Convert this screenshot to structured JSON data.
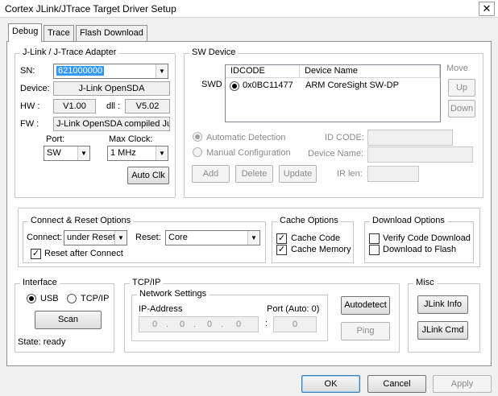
{
  "window": {
    "title": "Cortex JLink/JTrace Target Driver Setup",
    "close_glyph": "✕"
  },
  "tabs": [
    {
      "label": "Debug"
    },
    {
      "label": "Trace"
    },
    {
      "label": "Flash Download"
    }
  ],
  "jlink": {
    "legend": "J-Link / J-Trace Adapter",
    "sn_label": "SN:",
    "sn_value": "621000000",
    "device_label": "Device:",
    "device_value": "J-Link OpenSDA",
    "hw_label": "HW :",
    "hw_value": "V1.00",
    "dll_label": "dll :",
    "dll_value": "V5.02",
    "fw_label": "FW :",
    "fw_value": "J-Link OpenSDA compiled Jur",
    "port_label": "Port:",
    "port_value": "SW",
    "maxclock_label": "Max Clock:",
    "maxclock_value": "1 MHz",
    "autoclk_button": "Auto Clk"
  },
  "swdevice": {
    "legend": "SW Device",
    "swd_label": "SWD",
    "columns": [
      "IDCODE",
      "Device Name"
    ],
    "rows": [
      {
        "idcode": "0x0BC11477",
        "name": "ARM CoreSight SW-DP"
      }
    ],
    "move_label": "Move",
    "up_button": "Up",
    "down_button": "Down",
    "auto_detect_label": "Automatic Detection",
    "manual_config_label": "Manual Configuration",
    "idcode_label": "ID CODE:",
    "device_name_label": "Device Name:",
    "ir_len_label": "IR len:",
    "add_button": "Add",
    "delete_button": "Delete",
    "update_button": "Update"
  },
  "connect": {
    "legend": "Connect & Reset Options",
    "connect_label": "Connect:",
    "connect_value": "under Reset",
    "reset_label": "Reset:",
    "reset_value": "Core",
    "reset_after_connect_label": "Reset after Connect",
    "reset_after_connect_checked": "✓"
  },
  "cache": {
    "legend": "Cache Options",
    "cache_code_label": "Cache Code",
    "cache_code_checked": "✓",
    "cache_memory_label": "Cache Memory",
    "cache_memory_checked": "✓"
  },
  "download": {
    "legend": "Download Options",
    "verify_label": "Verify Code Download",
    "flash_label": "Download to Flash"
  },
  "interface": {
    "legend": "Interface",
    "usb_label": "USB",
    "tcpip_label": "TCP/IP",
    "scan_button": "Scan",
    "state_text": "State: ready"
  },
  "tcpip": {
    "legend": "TCP/IP",
    "network_legend": "Network Settings",
    "ip_label": "IP-Address",
    "port_label": "Port (Auto: 0)",
    "ip_octets": [
      "0",
      "0",
      "0",
      "0"
    ],
    "ip_dot": ".",
    "port_sep": ":",
    "port_value": "0",
    "autodetect_button": "Autodetect",
    "ping_button": "Ping"
  },
  "misc": {
    "legend": "Misc",
    "jlink_info_button": "JLink Info",
    "jlink_cmd_button": "JLink Cmd"
  },
  "footer": {
    "ok_button": "OK",
    "cancel_button": "Cancel",
    "apply_button": "Apply"
  },
  "icons": {
    "dropdown": "▼"
  }
}
